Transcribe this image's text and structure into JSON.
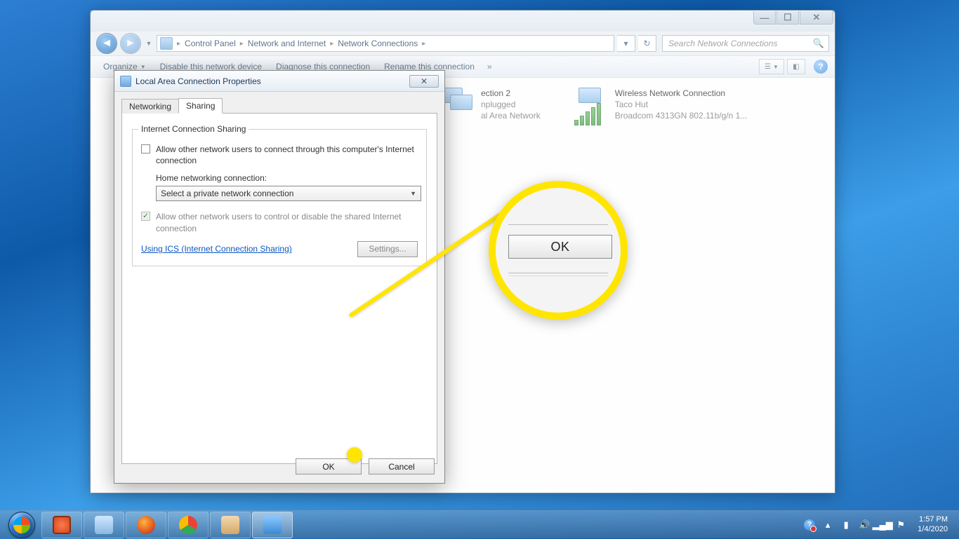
{
  "explorer": {
    "breadcrumb": [
      "Control Panel",
      "Network and Internet",
      "Network Connections"
    ],
    "search_placeholder": "Search Network Connections",
    "toolbar": {
      "organize": "Organize",
      "disable": "Disable this network device",
      "diagnose": "Diagnose this connection",
      "rename": "Rename this connection"
    },
    "connections": [
      {
        "name_suffix": "ection 2",
        "status": "nplugged",
        "device": "al Area Network"
      },
      {
        "name": "Wireless Network Connection",
        "status": "Taco Hut",
        "device": "Broadcom 4313GN 802.11b/g/n 1..."
      }
    ]
  },
  "dialog": {
    "title": "Local Area Connection Properties",
    "tabs": {
      "networking": "Networking",
      "sharing": "Sharing"
    },
    "group_title": "Internet Connection Sharing",
    "allow_connect": "Allow other network users to connect through this computer's Internet connection",
    "home_label": "Home networking connection:",
    "combo_text": "Select a private network connection",
    "allow_control": "Allow other network users to control or disable the shared Internet connection",
    "ics_link": "Using ICS (Internet Connection Sharing)",
    "settings_btn": "Settings...",
    "ok": "OK",
    "cancel": "Cancel"
  },
  "callout": {
    "big_ok": "OK"
  },
  "tray": {
    "time": "1:57 PM",
    "date": "1/4/2020"
  },
  "win_btns": {
    "min": "—",
    "max": "☐",
    "close": "✕"
  }
}
